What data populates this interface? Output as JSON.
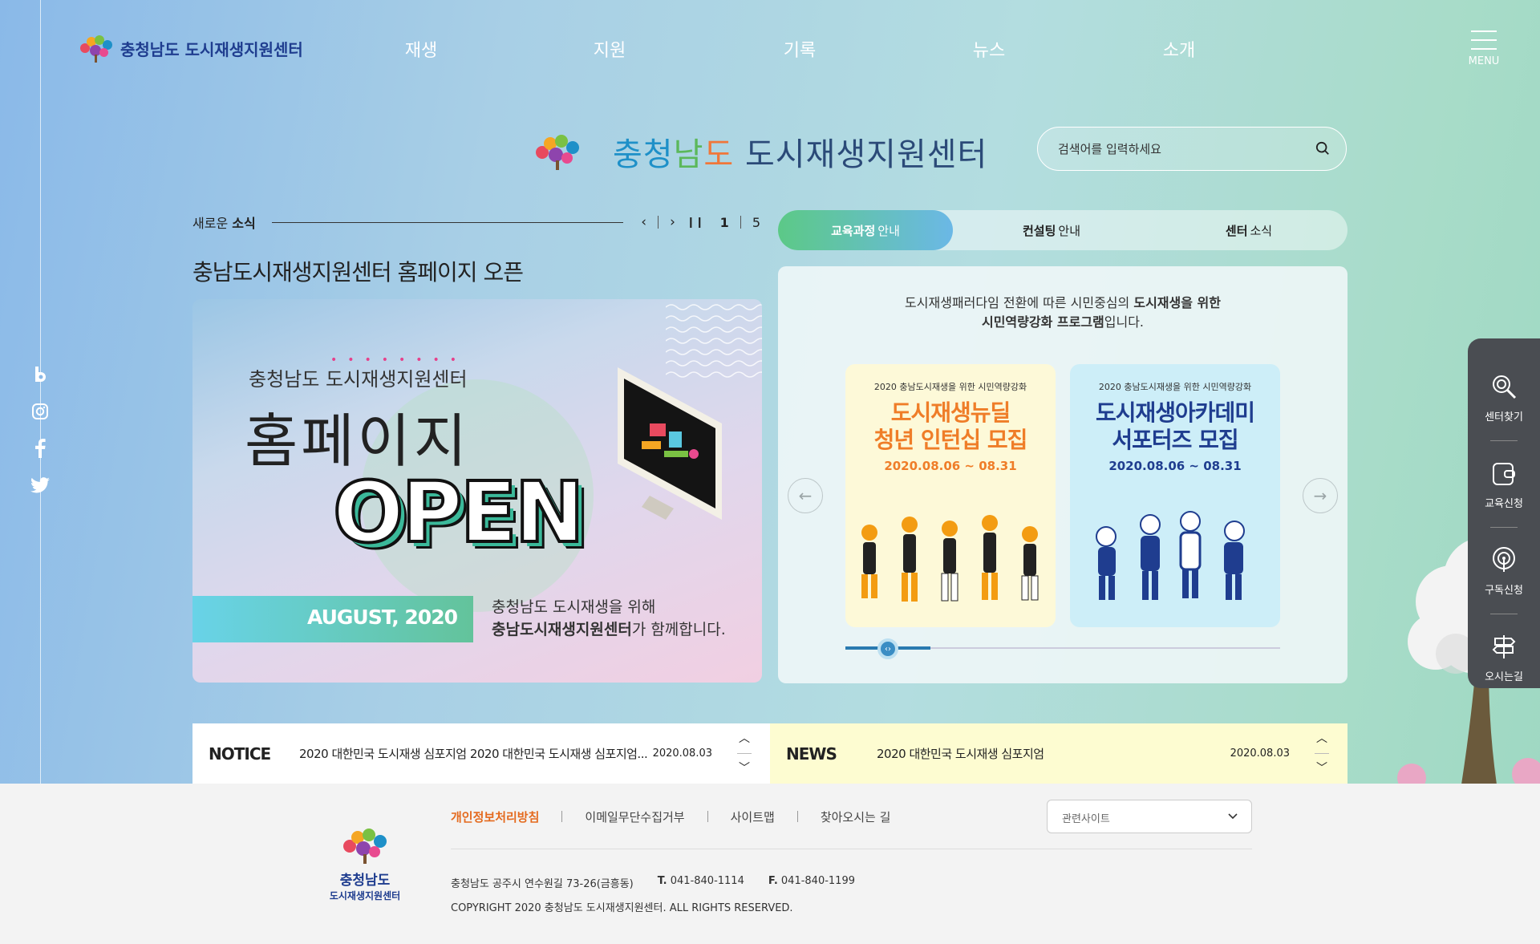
{
  "header": {
    "logo_text": "충청남도 도시재생지원센터",
    "nav": [
      "재생",
      "지원",
      "기록",
      "뉴스",
      "소개"
    ],
    "menu_label": "MENU"
  },
  "brand": {
    "part1": "충청",
    "part2": "남",
    "part3": "도",
    "part4": "도시재생지원센터"
  },
  "search": {
    "placeholder": "검색어를 입력하세요"
  },
  "news": {
    "label_plain": "새로운",
    "label_bold": "소식",
    "current_page": "1",
    "total_pages": "5",
    "title": "충남도시재생지원센터 홈페이지 오픈"
  },
  "banner": {
    "subtitle": "충청남도 도시재생지원센터",
    "headline": "홈페이지",
    "open": "OPEN",
    "date": "AUGUST, 2020",
    "desc_line1": "충청남도 도시재생을 위해",
    "desc_bold": "충남도시재생지원센터",
    "desc_tail": "가 함께합니다."
  },
  "tabs": [
    {
      "bold": "교육과정",
      "rest": "안내"
    },
    {
      "bold": "컨설팅",
      "rest": "안내"
    },
    {
      "bold": "센터",
      "rest": "소식"
    }
  ],
  "program": {
    "intro1_plain": "도시재생패러다임 전환에 따른 시민중심의",
    "intro1_bold": "도시재생을 위한",
    "intro2_bold": "시민역량강화 프로그램",
    "intro2_plain": "입니다.",
    "cards": [
      {
        "kicker": "2020 충남도시재생을 위한 시민역량강화",
        "line1": "도시재생뉴딜",
        "line2": "청년 인턴십 모집",
        "period": "2020.08.06 ~ 08.31"
      },
      {
        "kicker": "2020 충남도시재생을 위한 시민역량강화",
        "line1": "도시재생아카데미",
        "line2": "서포터즈 모집",
        "period": "2020.08.06 ~ 08.31"
      }
    ]
  },
  "quick_menu": [
    "센터찾기",
    "교육신청",
    "구독신청",
    "오시는길"
  ],
  "notice": {
    "heading": "NOTICE",
    "text": "2020 대한민국 도시재생 심포지엄 2020 대한민국 도시재생 심포지엄...",
    "date": "2020.08.03"
  },
  "newsbar": {
    "heading": "NEWS",
    "text": "2020 대한민국 도시재생 심포지엄",
    "date": "2020.08.03"
  },
  "footer": {
    "logo_line1": "충청남도",
    "logo_line2": "도시재생지원센터",
    "links": [
      "개인정보처리방침",
      "이메일무단수집거부",
      "사이트맵",
      "찾아오시는 길"
    ],
    "related_select": "관련사이트",
    "address": "충청남도 공주시 연수원길 73-26(금흥동)",
    "tel_label": "T.",
    "tel": "041-840-1114",
    "fax_label": "F.",
    "fax": "041-840-1199",
    "copyright": "COPYRIGHT 2020 충청남도 도시재생지원센터. ALL RIGHTS RESERVED."
  },
  "colors": {
    "accent_orange": "#e46a1e",
    "navy": "#1f3d8f",
    "notice_bg": "#ffffff",
    "news_bg": "#fdfcd1",
    "quick_bg": "#4a4d52"
  },
  "icons": [
    "hamburger-menu-icon",
    "search-icon",
    "blog-icon",
    "instagram-icon",
    "facebook-icon",
    "twitter-icon",
    "center-find-icon",
    "edu-apply-icon",
    "subscribe-icon",
    "directions-icon",
    "prev-arrow-icon",
    "next-arrow-icon",
    "pause-icon",
    "chevron-up-icon",
    "chevron-down-icon"
  ]
}
